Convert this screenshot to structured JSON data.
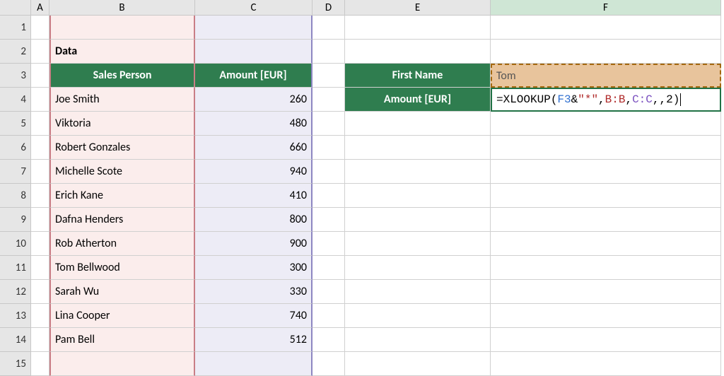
{
  "columns": {
    "rh": "",
    "A": "A",
    "B": "B",
    "C": "C",
    "D": "D",
    "E": "E",
    "F": "F"
  },
  "row_numbers": [
    "1",
    "2",
    "3",
    "4",
    "5",
    "6",
    "7",
    "8",
    "9",
    "10",
    "11",
    "12",
    "13",
    "14",
    "15"
  ],
  "cells": {
    "B2": "Data",
    "B3": "Sales Person",
    "C3": "Amount [EUR]",
    "E3": "First Name",
    "F3": "Tom",
    "E4": "Amount [EUR]"
  },
  "formula": {
    "prefix": "=XLOOKUP(",
    "ref1": "F3",
    "amp": "&",
    "str": "\"*\"",
    "comma1": ",",
    "ref2": "B:B",
    "comma2": ",",
    "ref3": "C:C",
    "tail": ",,2)"
  },
  "data_rows": [
    {
      "name": "Joe Smith",
      "amount": "260"
    },
    {
      "name": "Viktoria",
      "amount": "480"
    },
    {
      "name": "Robert Gonzales",
      "amount": "660"
    },
    {
      "name": "Michelle Scote",
      "amount": "940"
    },
    {
      "name": "Erich Kane",
      "amount": "410"
    },
    {
      "name": "Dafna Henders",
      "amount": "800"
    },
    {
      "name": "Rob Atherton",
      "amount": "900"
    },
    {
      "name": "Tom Bellwood",
      "amount": "300"
    },
    {
      "name": "Sarah Wu",
      "amount": "330"
    },
    {
      "name": "Lina Cooper",
      "amount": "740"
    },
    {
      "name": "Pam Bell",
      "amount": "512"
    }
  ],
  "chart_data": {
    "type": "table",
    "title": "Data",
    "columns": [
      "Sales Person",
      "Amount [EUR]"
    ],
    "rows": [
      [
        "Joe Smith",
        260
      ],
      [
        "Viktoria",
        480
      ],
      [
        "Robert Gonzales",
        660
      ],
      [
        "Michelle Scote",
        940
      ],
      [
        "Erich Kane",
        410
      ],
      [
        "Dafna Henders",
        800
      ],
      [
        "Rob Atherton",
        900
      ],
      [
        "Tom Bellwood",
        300
      ],
      [
        "Sarah Wu",
        330
      ],
      [
        "Lina Cooper",
        740
      ],
      [
        "Pam Bell",
        512
      ]
    ],
    "lookup": {
      "First Name": "Tom",
      "Amount [EUR]": "=XLOOKUP(F3&\"*\",B:B,C:C,,2)"
    }
  }
}
